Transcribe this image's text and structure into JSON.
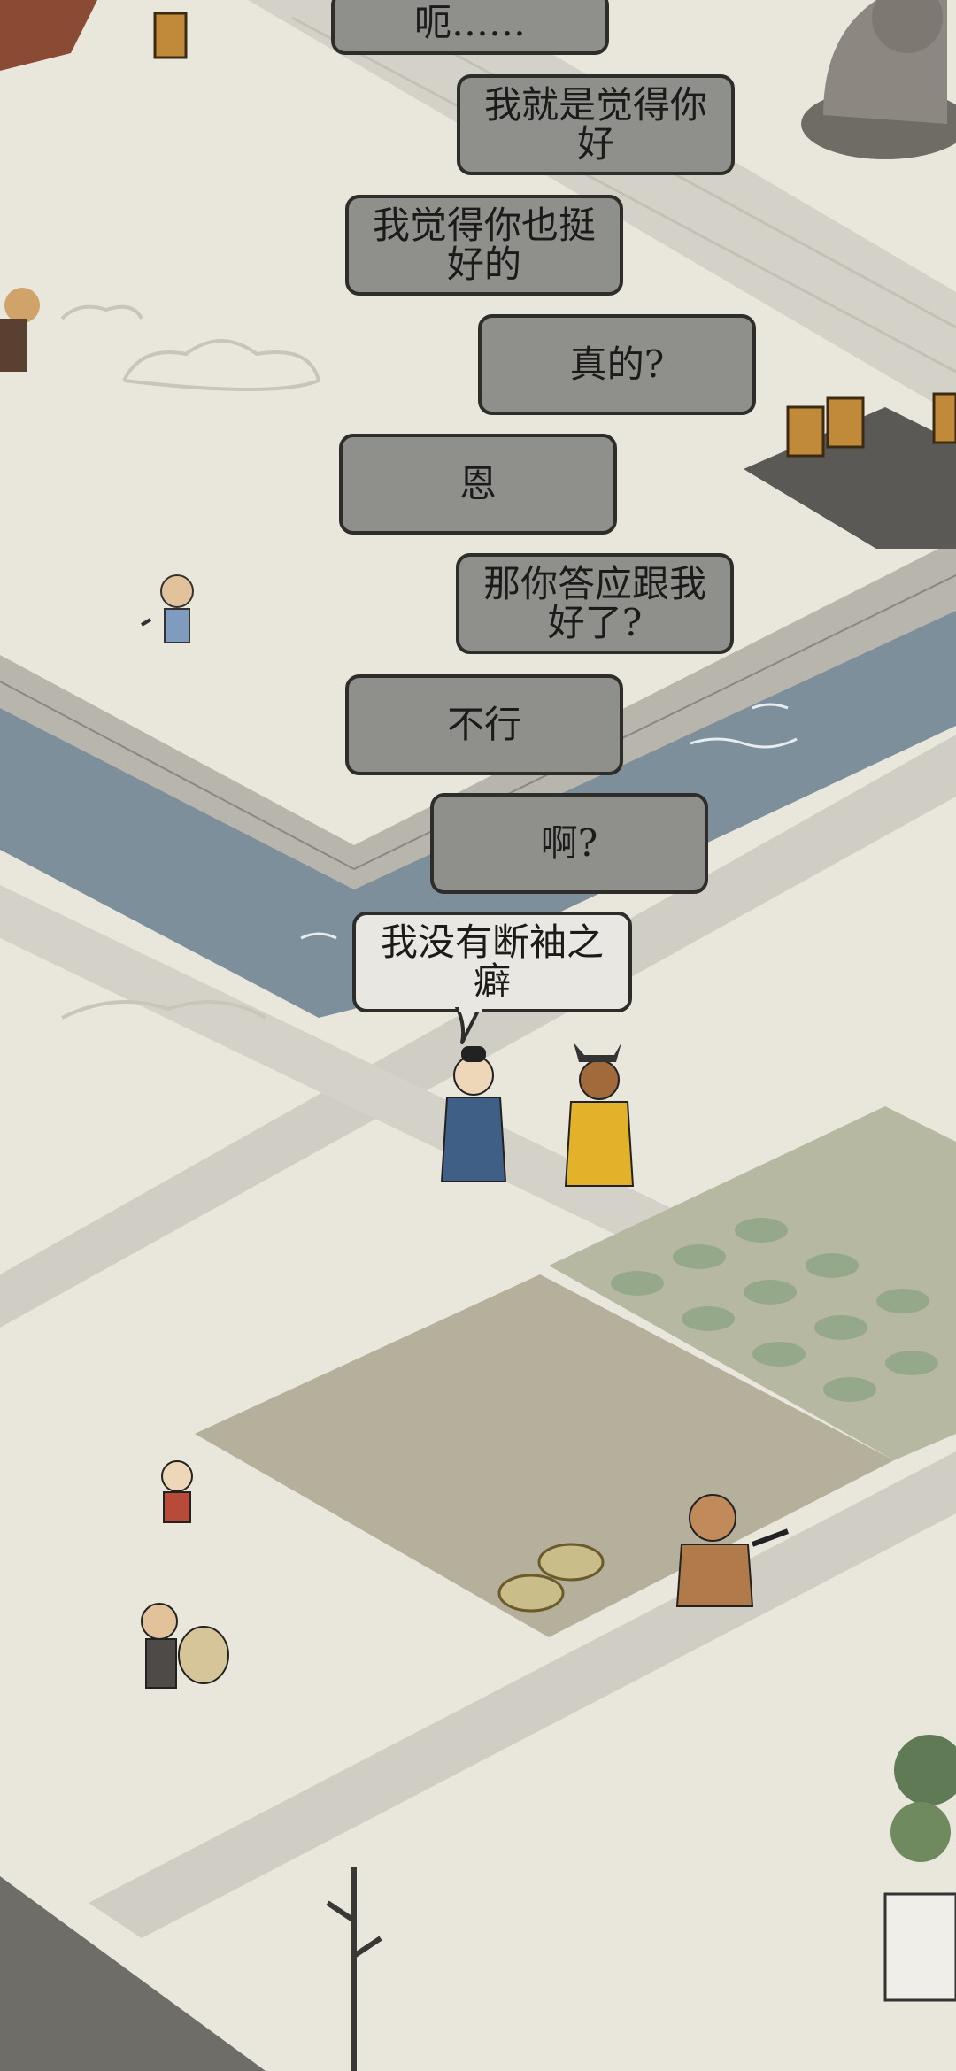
{
  "dialogue": [
    {
      "speaker": "npc",
      "text": "呃……"
    },
    {
      "speaker": "player",
      "text": "我就是觉得你好"
    },
    {
      "speaker": "npc",
      "text": "我觉得你也挺好的"
    },
    {
      "speaker": "player",
      "text": "真的?"
    },
    {
      "speaker": "npc",
      "text": "恩"
    },
    {
      "speaker": "player",
      "text": "那你答应跟我好了?"
    },
    {
      "speaker": "npc",
      "text": "不行"
    },
    {
      "speaker": "player",
      "text": "啊?"
    },
    {
      "speaker": "npc",
      "text": "我没有断袖之癖",
      "current": true
    }
  ],
  "colors": {
    "ground": "#e9e7dc",
    "wall_stone": "#b9b6ad",
    "water": "#7e8f9c",
    "bubble_fill": "#8f8f8c",
    "bubble_current": "#e8e7e2",
    "bubble_border": "#2e2d2a",
    "scholar_robe": "#3f5f86",
    "official_robe": "#e4b22a",
    "field": "#b5b09c"
  },
  "characters": [
    "scholar-npc",
    "official-player",
    "child-villager",
    "porter-villager",
    "brute-villager",
    "little-boy-villager",
    "porter-villager-top"
  ],
  "props": [
    "buddha-statue",
    "wooden-buckets",
    "vegetable-field",
    "rice-paddy",
    "baskets",
    "bare-tree",
    "potted-plant",
    "city-wall"
  ]
}
